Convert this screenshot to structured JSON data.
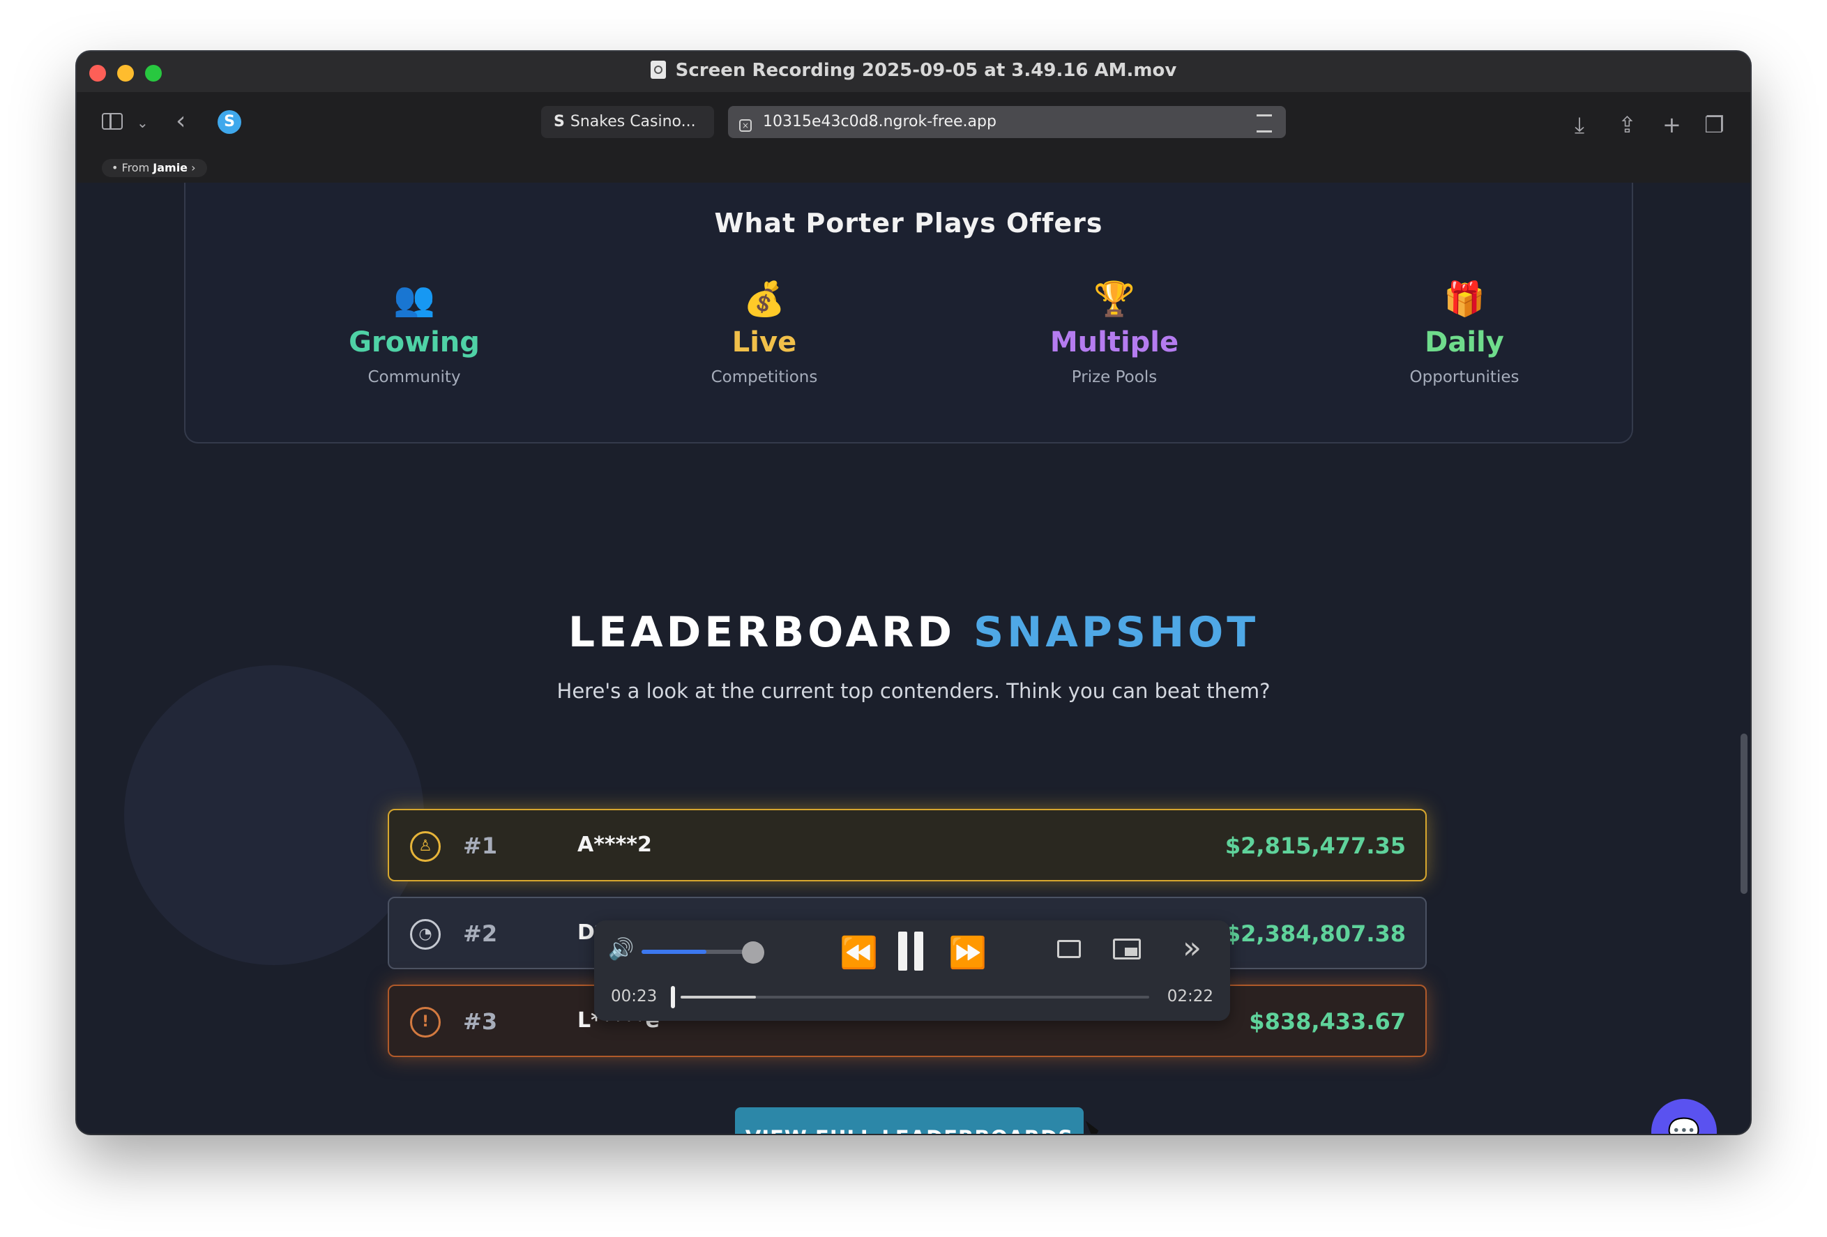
{
  "window": {
    "title": "Screen Recording 2025-09-05 at 3.49.16 AM.mov"
  },
  "browser": {
    "tab1_label": "Snakes Casino...",
    "tab1_logo": "S",
    "tab2_url": "10315e43c0d8.ngrok-free.app",
    "from_label": "From",
    "from_name": "Jamie"
  },
  "offers": {
    "title": "What Porter Plays Offers",
    "items": [
      {
        "icon": "👥",
        "big": "Growing",
        "small": "Community",
        "color": "#4fd2a6"
      },
      {
        "icon": "💰",
        "big": "Live",
        "small": "Competitions",
        "color": "#f1c04a"
      },
      {
        "icon": "🏆",
        "big": "Multiple",
        "small": "Prize Pools",
        "color": "#b57cf0"
      },
      {
        "icon": "🎁",
        "big": "Daily",
        "small": "Opportunities",
        "color": "#6fdc8c"
      }
    ]
  },
  "leaderboard": {
    "title_main": "LEADERBOARD",
    "title_accent": "SNAPSHOT",
    "subtitle": "Here's a look at the current top contenders. Think you can beat them?",
    "rows": [
      {
        "rank": "#1",
        "icon": "♙",
        "player": "A****2",
        "amount": "$2,815,477.35"
      },
      {
        "rank": "#2",
        "icon": "◔",
        "player": "D*",
        "amount": "$2,384,807.38"
      },
      {
        "rank": "#3",
        "icon": "!",
        "player": "L*****e",
        "amount": "$838,433.67"
      }
    ],
    "cta": "VIEW FULL LEADERBOARDS"
  },
  "player_controls": {
    "elapsed": "00:23",
    "duration": "02:22",
    "progress_fraction": 0.16,
    "volume_fraction": 0.58
  },
  "colors": {
    "accent": "#2c87a8",
    "gold": "#e6b439",
    "silver": "#c4c8d0",
    "bronze": "#d37a40",
    "money": "#5fd39b",
    "chat": "#5a52f0"
  }
}
